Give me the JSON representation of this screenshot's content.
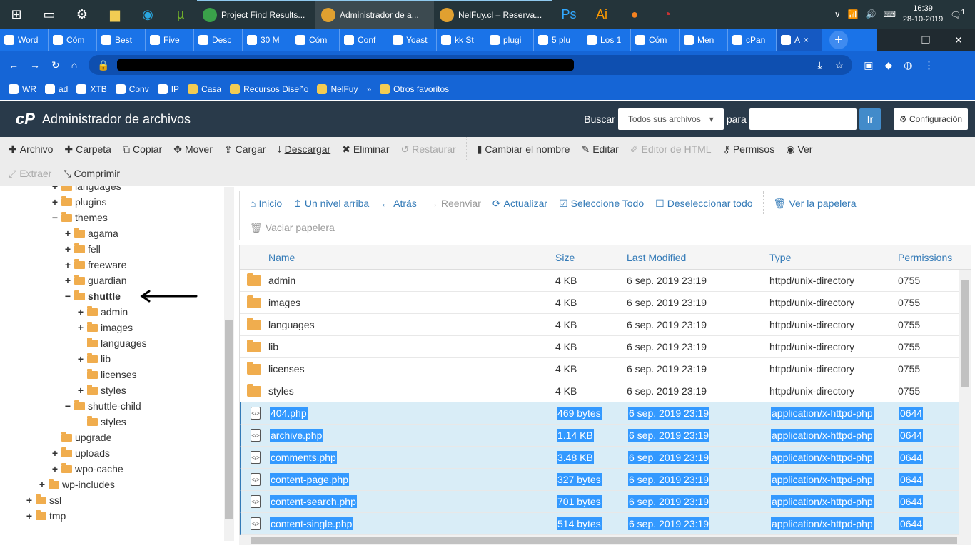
{
  "taskbar": {
    "apps": [
      {
        "label": "Project Find Results...",
        "color": "#3aa14a"
      },
      {
        "label": "Administrador de a...",
        "color": "#e0a030",
        "active": true
      },
      {
        "label": "NelFuy.cl – Reserva...",
        "color": "#e0a030"
      }
    ],
    "time": "16:39",
    "date": "28-10-2019",
    "notif": "1"
  },
  "chrome": {
    "tabs": [
      "Word",
      "Cóm",
      "Best",
      "Five",
      "Desc",
      "30 M",
      "Cóm",
      "Conf",
      "Yoast",
      "kk St",
      "plugi",
      "5 plu",
      "Los 1",
      "Cóm",
      "Men",
      "cPan",
      "A"
    ],
    "active_close": "×",
    "new_tab": "+",
    "win": [
      "–",
      "❐",
      "✕"
    ]
  },
  "bookmarks": [
    "WR",
    "ad",
    "XTB",
    "Conv",
    "IP",
    "Casa",
    "Recursos Diseño",
    "NelFuy",
    "»",
    "Otros favoritos"
  ],
  "header": {
    "logo": "cP",
    "title": "Administrador de archivos",
    "search_label": "Buscar",
    "search_scope": "Todos sus archivos",
    "para": "para",
    "go": "Ir",
    "config": "Configuración"
  },
  "toolbar": {
    "row1": [
      {
        "icon": "plus",
        "label": "Archivo"
      },
      {
        "icon": "plus",
        "label": "Carpeta"
      },
      {
        "icon": "copy",
        "label": "Copiar"
      },
      {
        "icon": "move",
        "label": "Mover"
      },
      {
        "icon": "upload",
        "label": "Cargar"
      },
      {
        "icon": "download",
        "label": "Descargar"
      },
      {
        "icon": "x",
        "label": "Eliminar"
      },
      {
        "icon": "undo",
        "label": "Restaurar",
        "disabled": true
      },
      {
        "icon": "file",
        "label": "Cambiar el nombre"
      },
      {
        "icon": "pencil",
        "label": "Editar"
      },
      {
        "icon": "edit",
        "label": "Editor de HTML",
        "disabled": true
      },
      {
        "icon": "key",
        "label": "Permisos"
      },
      {
        "icon": "eye",
        "label": "Ver"
      }
    ],
    "row2": [
      {
        "icon": "expand",
        "label": "Extraer",
        "disabled": true
      },
      {
        "icon": "compress",
        "label": "Comprimir"
      }
    ]
  },
  "tree": [
    {
      "label": "languages",
      "level": 3,
      "pm": "+"
    },
    {
      "label": "plugins",
      "level": 3,
      "pm": "+"
    },
    {
      "label": "themes",
      "level": 3,
      "pm": "−",
      "open": true
    },
    {
      "label": "agama",
      "level": 4,
      "pm": "+"
    },
    {
      "label": "fell",
      "level": 4,
      "pm": "+"
    },
    {
      "label": "freeware",
      "level": 4,
      "pm": "+"
    },
    {
      "label": "guardian",
      "level": 4,
      "pm": "+"
    },
    {
      "label": "shuttle",
      "level": 4,
      "pm": "−",
      "open": true,
      "bold": true
    },
    {
      "label": "admin",
      "level": 5,
      "pm": "+"
    },
    {
      "label": "images",
      "level": 5,
      "pm": "+"
    },
    {
      "label": "languages",
      "level": 5,
      "pm": ""
    },
    {
      "label": "lib",
      "level": 5,
      "pm": "+"
    },
    {
      "label": "licenses",
      "level": 5,
      "pm": ""
    },
    {
      "label": "styles",
      "level": 5,
      "pm": "+"
    },
    {
      "label": "shuttle-child",
      "level": 4,
      "pm": "−",
      "open": true
    },
    {
      "label": "styles",
      "level": 5,
      "pm": ""
    },
    {
      "label": "upgrade",
      "level": 3,
      "pm": ""
    },
    {
      "label": "uploads",
      "level": 3,
      "pm": "+"
    },
    {
      "label": "wpo-cache",
      "level": 3,
      "pm": "+"
    },
    {
      "label": "wp-includes",
      "level": 2,
      "pm": "+"
    },
    {
      "label": "ssl",
      "level": 1,
      "pm": "+"
    },
    {
      "label": "tmp",
      "level": 1,
      "pm": "+"
    }
  ],
  "actions": {
    "row1": [
      {
        "icon": "home",
        "label": "Inicio"
      },
      {
        "icon": "level-up",
        "label": "Un nivel arriba"
      },
      {
        "icon": "arrow-left",
        "label": "Atrás"
      },
      {
        "icon": "arrow-right",
        "label": "Reenviar",
        "disabled": true
      },
      {
        "icon": "refresh",
        "label": "Actualizar"
      },
      {
        "icon": "check-square",
        "label": "Seleccione Todo"
      },
      {
        "icon": "square",
        "label": "Deseleccionar todo"
      },
      {
        "icon": "trash",
        "label": "Ver la papelera"
      }
    ],
    "row2": [
      {
        "icon": "trash",
        "label": "Vaciar papelera",
        "disabled": true
      }
    ]
  },
  "files": {
    "columns": [
      "Name",
      "Size",
      "Last Modified",
      "Type",
      "Permissions"
    ],
    "rows": [
      {
        "name": "admin",
        "size": "4 KB",
        "modified": "6 sep. 2019 23:19",
        "type": "httpd/unix-directory",
        "perms": "0755",
        "dir": true
      },
      {
        "name": "images",
        "size": "4 KB",
        "modified": "6 sep. 2019 23:19",
        "type": "httpd/unix-directory",
        "perms": "0755",
        "dir": true
      },
      {
        "name": "languages",
        "size": "4 KB",
        "modified": "6 sep. 2019 23:19",
        "type": "httpd/unix-directory",
        "perms": "0755",
        "dir": true
      },
      {
        "name": "lib",
        "size": "4 KB",
        "modified": "6 sep. 2019 23:19",
        "type": "httpd/unix-directory",
        "perms": "0755",
        "dir": true
      },
      {
        "name": "licenses",
        "size": "4 KB",
        "modified": "6 sep. 2019 23:19",
        "type": "httpd/unix-directory",
        "perms": "0755",
        "dir": true
      },
      {
        "name": "styles",
        "size": "4 KB",
        "modified": "6 sep. 2019 23:19",
        "type": "httpd/unix-directory",
        "perms": "0755",
        "dir": true
      },
      {
        "name": "404.php",
        "size": "469 bytes",
        "modified": "6 sep. 2019 23:19",
        "type": "application/x-httpd-php",
        "perms": "0644",
        "selected": true
      },
      {
        "name": "archive.php",
        "size": "1.14 KB",
        "modified": "6 sep. 2019 23:19",
        "type": "application/x-httpd-php",
        "perms": "0644",
        "selected": true
      },
      {
        "name": "comments.php",
        "size": "3.48 KB",
        "modified": "6 sep. 2019 23:19",
        "type": "application/x-httpd-php",
        "perms": "0644",
        "selected": true
      },
      {
        "name": "content-page.php",
        "size": "327 bytes",
        "modified": "6 sep. 2019 23:19",
        "type": "application/x-httpd-php",
        "perms": "0644",
        "selected": true
      },
      {
        "name": "content-search.php",
        "size": "701 bytes",
        "modified": "6 sep. 2019 23:19",
        "type": "application/x-httpd-php",
        "perms": "0644",
        "selected": true
      },
      {
        "name": "content-single.php",
        "size": "514 bytes",
        "modified": "6 sep. 2019 23:19",
        "type": "application/x-httpd-php",
        "perms": "0644",
        "selected": true
      }
    ]
  }
}
